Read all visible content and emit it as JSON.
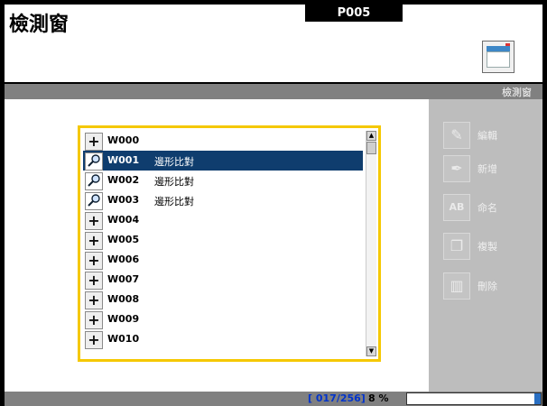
{
  "app": {
    "title": "檢測窗",
    "program_code": "P005",
    "window_label": "檢測窗"
  },
  "list": {
    "selected_index": 1,
    "items": [
      {
        "id": "W000",
        "name": "",
        "icon": "plus-icon"
      },
      {
        "id": "W001",
        "name": "邊形比對",
        "icon": "pattern-search-icon"
      },
      {
        "id": "W002",
        "name": "邊形比對",
        "icon": "pattern-search-icon"
      },
      {
        "id": "W003",
        "name": "邊形比對",
        "icon": "pattern-search-icon"
      },
      {
        "id": "W004",
        "name": "",
        "icon": "plus-icon"
      },
      {
        "id": "W005",
        "name": "",
        "icon": "plus-icon"
      },
      {
        "id": "W006",
        "name": "",
        "icon": "plus-icon"
      },
      {
        "id": "W007",
        "name": "",
        "icon": "plus-icon"
      },
      {
        "id": "W008",
        "name": "",
        "icon": "plus-icon"
      },
      {
        "id": "W009",
        "name": "",
        "icon": "plus-icon"
      },
      {
        "id": "W010",
        "name": "",
        "icon": "plus-icon"
      }
    ]
  },
  "actions": {
    "edit": {
      "label": "編輯",
      "icon": "edit-icon"
    },
    "new": {
      "label": "新增",
      "icon": "pen-icon"
    },
    "rename": {
      "label": "命名",
      "icon": "rename-icon"
    },
    "copy": {
      "label": "複製",
      "icon": "copy-icon"
    },
    "delete": {
      "label": "刪除",
      "icon": "trash-icon"
    }
  },
  "status": {
    "counter": "[ 017/256]",
    "percent": "8 %",
    "memory_fraction": 0.05
  },
  "colors": {
    "selection": "#0f3d6e",
    "list_border": "#f5c800",
    "counter_text": "#0033cc",
    "memory_fill": "#2a6fc2"
  }
}
